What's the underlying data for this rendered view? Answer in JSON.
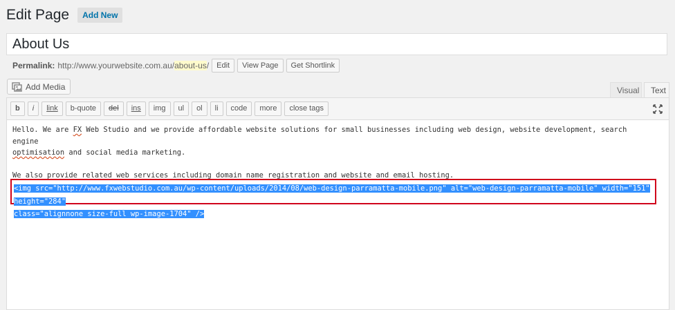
{
  "header": {
    "title": "Edit Page",
    "add_new_label": "Add New"
  },
  "post": {
    "title": "About Us"
  },
  "permalink": {
    "label": "Permalink:",
    "base_url": "http://www.yourwebsite.com.au/",
    "slug": "about-us",
    "trailing": "/",
    "edit_label": "Edit",
    "view_label": "View Page",
    "shortlink_label": "Get Shortlink"
  },
  "media": {
    "add_media_label": "Add Media",
    "icon": "add-media-icon"
  },
  "editor_tabs": {
    "visual": "Visual",
    "text": "Text",
    "active": "Text"
  },
  "quicktags": [
    "b",
    "i",
    "link",
    "b-quote",
    "del",
    "ins",
    "img",
    "ul",
    "ol",
    "li",
    "code",
    "more",
    "close tags"
  ],
  "editor": {
    "paragraph1_a": "Hello. We are ",
    "paragraph1_fx": "FX",
    "paragraph1_b": " Web Studio and we provide affordable website solutions for small businesses including web design, website development, search engine",
    "paragraph1_c_word": "optimisation",
    "paragraph1_c_rest": " and social media marketing.",
    "paragraph2": "We also provide related web services including domain name registration and website and email hosting.",
    "code_line1": "<img src=\"http://www.fxwebstudio.com.au/wp-content/uploads/2014/08/web-design-parramatta-mobile.png\" alt=\"web-design-parramatta-mobile\" width=\"151\" height=\"284\"",
    "code_line2": "class=\"alignnone size-full wp-image-1704\" />"
  },
  "colors": {
    "highlight": "#3390ff",
    "selection_border": "#d0021b",
    "link": "#0073aa"
  }
}
